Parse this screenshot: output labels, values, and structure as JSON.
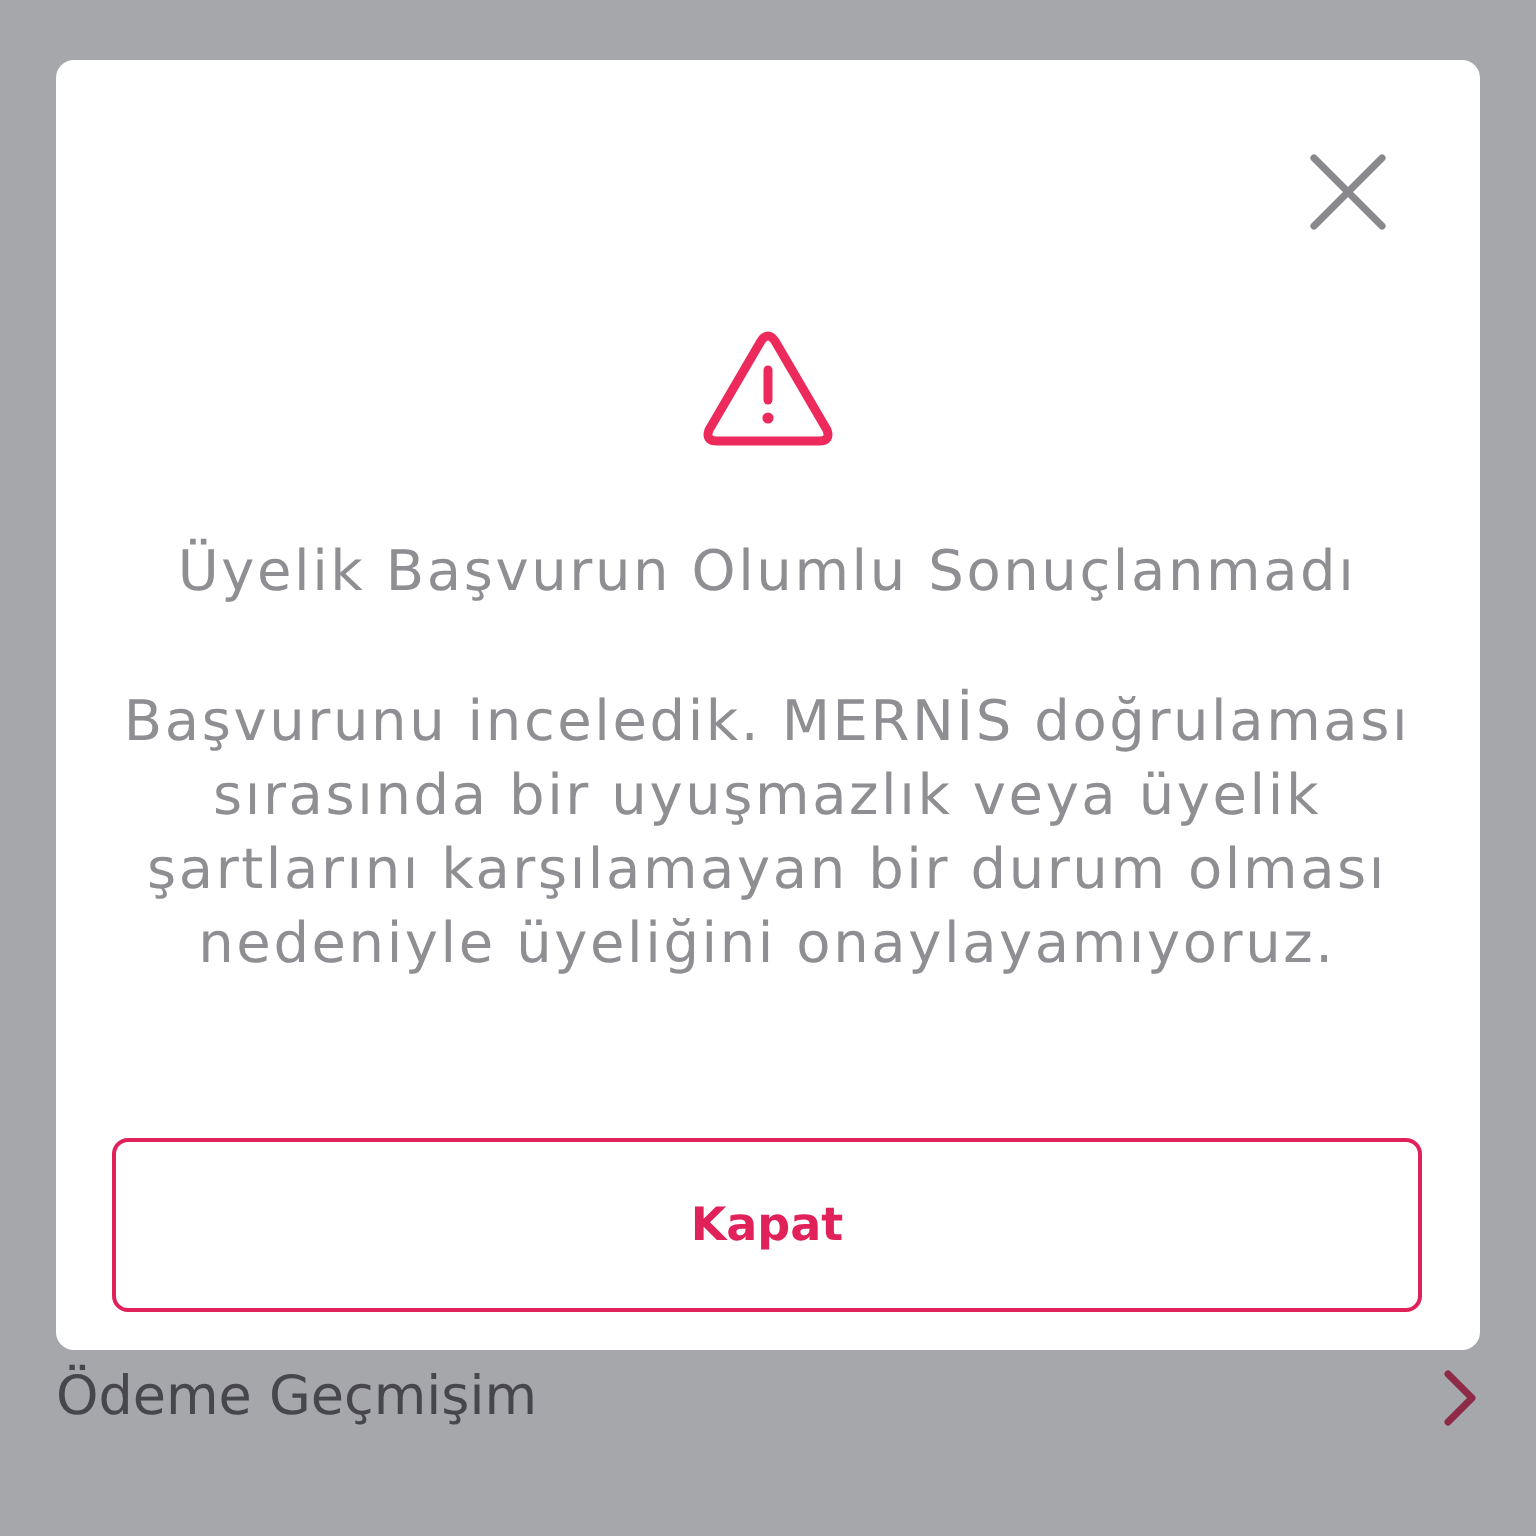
{
  "background": {
    "menu_item": {
      "label": "Ödeme Geçmişim"
    }
  },
  "dialog": {
    "title": "Üyelik Başvurun Olumlu Sonuçlanmadı",
    "message": "Başvurunu inceledik. MERNİS doğrulaması sırasında bir uyuşmazlık veya üyelik şartlarını karşılamayan bir durum olması nedeniyle üyeliğini onaylayamıyoruz.",
    "button": {
      "label": "Kapat"
    }
  }
}
